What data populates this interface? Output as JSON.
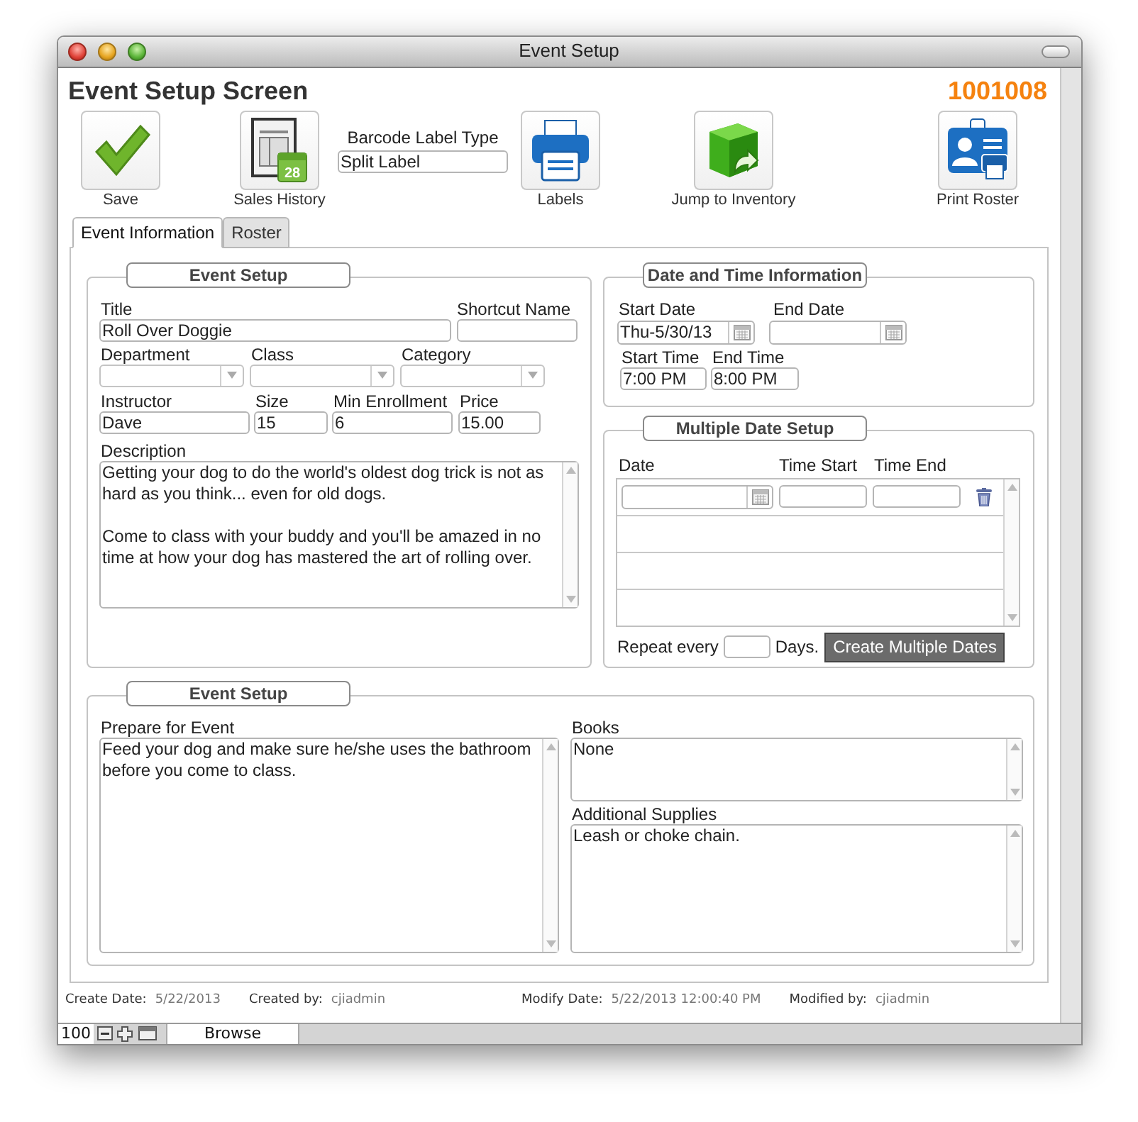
{
  "window": {
    "title": "Event Setup"
  },
  "header": {
    "title": "Event Setup Screen",
    "record_number": "1001008"
  },
  "toolbar": [
    {
      "kind": "button",
      "label": "Save"
    },
    {
      "kind": "button",
      "label": "Sales History",
      "calendar_day": "28"
    },
    {
      "kind": "field",
      "label": "Barcode Label Type",
      "value": "Split Label"
    },
    {
      "kind": "button",
      "label": "Labels"
    },
    {
      "kind": "button",
      "label": "Jump to Inventory"
    },
    {
      "kind": "button",
      "label": "Print Roster"
    }
  ],
  "tabs": [
    {
      "label": "Event Information",
      "selected": true
    },
    {
      "label": "Roster",
      "selected": false
    }
  ],
  "event_setup": {
    "heading": "Event Setup",
    "title": {
      "label": "Title",
      "value": "Roll Over Doggie"
    },
    "shortcut_name": {
      "label": "Shortcut Name"
    },
    "department": {
      "label": "Department"
    },
    "class": {
      "label": "Class"
    },
    "category": {
      "label": "Category"
    },
    "instructor": {
      "label": "Instructor",
      "value": "Dave"
    },
    "size": {
      "label": "Size",
      "value": "15"
    },
    "min_enrollment": {
      "label": "Min Enrollment",
      "value": "6"
    },
    "price": {
      "label": "Price",
      "value": "15.00"
    },
    "description": {
      "label": "Description",
      "value": "Getting your dog to do the world's oldest dog trick is not as hard as you think... even for old dogs.\n\nCome to class with your buddy and you'll be amazed in no time at how your dog has mastered the art of rolling over."
    }
  },
  "date_time": {
    "heading": "Date and Time Information",
    "start_date": {
      "label": "Start Date",
      "value": "Thu-5/30/13"
    },
    "end_date": {
      "label": "End Date"
    },
    "start_time": {
      "label": "Start Time",
      "value": "7:00 PM"
    },
    "end_time": {
      "label": "End Time",
      "value": "8:00 PM"
    }
  },
  "multiple_dates": {
    "heading": "Multiple Date Setup",
    "columns": [
      "Date",
      "Time Start",
      "Time End"
    ],
    "repeat_label": "Repeat every",
    "days_label": "Days.",
    "button": "Create Multiple Dates"
  },
  "notes": {
    "heading": "Event Setup",
    "prepare": {
      "label": "Prepare for Event",
      "value": "Feed your dog and make sure he/she uses the bathroom before you come to class."
    },
    "books": {
      "label": "Books",
      "value": "None"
    },
    "supplies": {
      "label": "Additional Supplies",
      "value": "Leash or choke chain."
    }
  },
  "footer": [
    {
      "label": "Create Date:",
      "value": "5/22/2013"
    },
    {
      "label": "Created by:",
      "value": "cjiadmin"
    },
    {
      "label": "Modify Date:",
      "value": "5/22/2013 12:00:40 PM"
    },
    {
      "label": "Modified by:",
      "value": "cjiadmin"
    }
  ],
  "status_bar": {
    "zoom": "100",
    "mode": "Browse"
  }
}
